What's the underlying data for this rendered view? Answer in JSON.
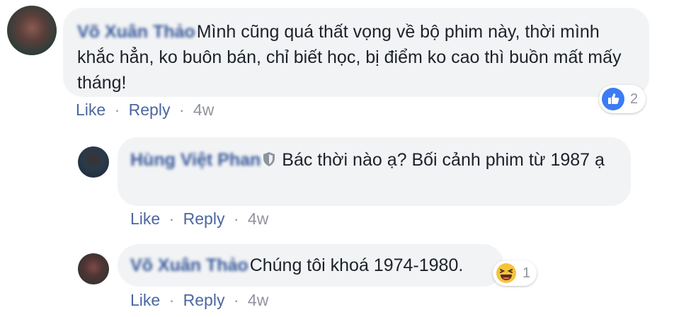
{
  "comment": {
    "author": "Võ Xuân Thảo",
    "text": "Mình cũng quá thất vọng về bộ phim này, thời mình khắc hẳn, ko buôn bán, chỉ biết học, bị điểm ko cao thì buồn mất mấy tháng!",
    "reaction_count": "2",
    "actions": {
      "like": "Like",
      "reply": "Reply",
      "dot": "·",
      "time": "4w"
    }
  },
  "replies": [
    {
      "author": "Hùng Việt Phan",
      "text": "Bác thời nào ạ? Bối cảnh phim từ 1987 ạ",
      "actions": {
        "like": "Like",
        "reply": "Reply",
        "dot": "·",
        "time": "4w"
      }
    },
    {
      "author": "Võ Xuân Thảo",
      "text": "Chúng tôi khoá 1974-1980.",
      "reaction_count": "1",
      "actions": {
        "like": "Like",
        "reply": "Reply",
        "dot": "·",
        "time": "4w"
      }
    }
  ],
  "colors": {
    "link": "#4b67a1",
    "author": "#365899",
    "bubble": "#f2f3f5",
    "meta": "#90949c",
    "like_blue": "#3b7cf5",
    "haha_yellow": "#f5c33b"
  },
  "icons": {
    "like_reaction": "thumbs-up-icon",
    "haha_reaction": "laughing-face-icon",
    "moderator_badge": "shield-icon"
  }
}
